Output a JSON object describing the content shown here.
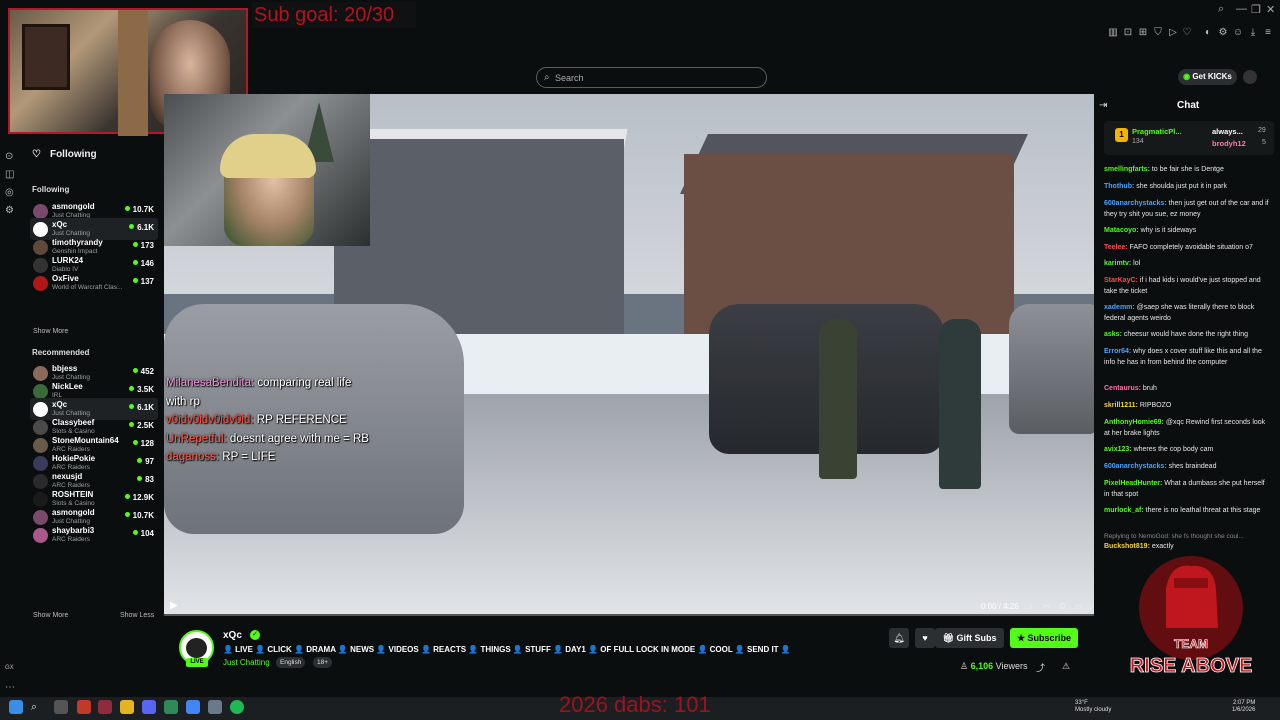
{
  "overlays": {
    "sub_goal": "Sub goal: 20/30",
    "dabs_counter": "2026 dabs: 101",
    "chat_lines": [
      {
        "user": "MilanesaBendita:",
        "text": " comparing real life"
      },
      {
        "user": "",
        "text": "with rp"
      },
      {
        "user": "v0idv0idv0idv0id:",
        "text": " RP REFERENCE"
      },
      {
        "user": "UnRepetful:",
        "text": " doesnt agree with me = RB"
      },
      {
        "user": "daganoss:",
        "text": " RP = LIFE"
      }
    ]
  },
  "search": {
    "placeholder": "Search"
  },
  "sidebar": {
    "following_header": "Following",
    "following_section": "Following",
    "following": [
      {
        "name": "asmongold",
        "category": "Just Chatting",
        "viewers": "10.7K",
        "avatar_color": "#7a4a6b"
      },
      {
        "name": "xQc",
        "category": "Just Chatting",
        "viewers": "6.1K",
        "avatar_color": "#ffffff",
        "active": true
      },
      {
        "name": "timothyrandy",
        "category": "Genshin Impact",
        "viewers": "173",
        "avatar_color": "#5f4a3a"
      },
      {
        "name": "LURK24",
        "category": "Diablo IV",
        "viewers": "146",
        "avatar_color": "#333333"
      },
      {
        "name": "OxFive",
        "category": "World of Warcraft Clas...",
        "viewers": "137",
        "avatar_color": "#b01818"
      }
    ],
    "show_more_1": "Show More",
    "recommended_section": "Recommended",
    "recommended": [
      {
        "name": "bbjess",
        "category": "Just Chatting",
        "viewers": "452",
        "avatar_color": "#8a6a5a"
      },
      {
        "name": "NickLee",
        "category": "IRL",
        "viewers": "3.5K",
        "avatar_color": "#3a6a3a"
      },
      {
        "name": "xQc",
        "category": "Just Chatting",
        "viewers": "6.1K",
        "avatar_color": "#ffffff",
        "active": true
      },
      {
        "name": "Classybeef",
        "category": "Slots & Casino",
        "viewers": "2.5K",
        "avatar_color": "#4a4a4a"
      },
      {
        "name": "StoneMountain64",
        "category": "ARC Raiders",
        "viewers": "128",
        "avatar_color": "#6a5a4a"
      },
      {
        "name": "HokiePokie",
        "category": "ARC Raiders",
        "viewers": "97",
        "avatar_color": "#3a3a5a"
      },
      {
        "name": "nexusjd",
        "category": "ARC Raiders",
        "viewers": "83",
        "avatar_color": "#2a2a2a"
      },
      {
        "name": "ROSHTEIN",
        "category": "Slots & Casino",
        "viewers": "12.9K",
        "avatar_color": "#1a1a1a"
      },
      {
        "name": "asmongold",
        "category": "Just Chatting",
        "viewers": "10.7K",
        "avatar_color": "#7a4a6b"
      },
      {
        "name": "shaybarbi3",
        "category": "ARC Raiders",
        "viewers": "104",
        "avatar_color": "#aa5a8a"
      }
    ],
    "show_more_2": "Show More",
    "show_less": "Show Less"
  },
  "player": {
    "timecode": "0:00 / 4:26"
  },
  "channel": {
    "name": "xQc",
    "live_badge": "LIVE",
    "title": "👤 LIVE 👤 CLICK 👤 DRAMA 👤 NEWS 👤 VIDEOS 👤 REACTS 👤 THINGS 👤 STUFF 👤 DAY1 👤 OF FULL LOCK IN MODE 👤 COOL 👤 SEND IT 👤",
    "category": "Just Chatting",
    "tags": [
      "English",
      "18+"
    ],
    "gift_subs": "Gift Subs",
    "subscribe": "Subscribe",
    "viewers_count": "6,106",
    "viewers_label": "Viewers"
  },
  "chat": {
    "get_kicks": "Get KICKs",
    "title": "Chat",
    "pinned": {
      "user1": "PragmaticPl...",
      "val1": "134",
      "user2": "always...",
      "val2": "29",
      "user3": "brodyh12",
      "val3": "5"
    },
    "messages": [
      {
        "user": "smellingfarts:",
        "text": " to be fair she is Dentge",
        "color": "c-green"
      },
      {
        "user": "Thothub:",
        "text": " she shoulda just put it in park",
        "color": "c-blue"
      },
      {
        "user": "600anarchystacks:",
        "text": " then just get out of the car and if they try shit you sue, ez money",
        "color": "c-blue"
      },
      {
        "user": "Matacoyo:",
        "text": " why is it sideways",
        "color": "c-green"
      },
      {
        "user": "Teelee:",
        "text": " FAFO completely avoidable situation o7",
        "color": "c-red"
      },
      {
        "user": "karimtv:",
        "text": " lol",
        "color": "c-green"
      },
      {
        "user": "StarKayC:",
        "text": " if i had kids i would've just stopped and take the ticket",
        "color": "c-red"
      },
      {
        "user": "xademm:",
        "text": " @saep she was literally there to block federal agents weirdo",
        "color": "c-blue"
      },
      {
        "user": "asks:",
        "text": " cheesur would have done the right thing",
        "color": "c-green"
      },
      {
        "user": "Error64:",
        "text": " why does x cover stuff like this and all the info he has in from behind the computer",
        "color": "c-blue"
      },
      {
        "user": "Centaurus:",
        "text": " bruh",
        "color": "c-pink"
      },
      {
        "user": "skrill1211:",
        "text": " RIPBOZO",
        "color": "c-yellow"
      },
      {
        "user": "AnthonyHomie69:",
        "text": " @xqc Rewind first seconds look at her brake lights",
        "color": "c-green"
      },
      {
        "user": "avix123:",
        "text": " wheres the cop body cam",
        "color": "c-green"
      },
      {
        "user": "600anarchystacks:",
        "text": " shes braindead",
        "color": "c-blue"
      },
      {
        "user": "PixelHeadHunter:",
        "text": " What a dumbass she put herself in that spot",
        "color": "c-green"
      },
      {
        "user": "murlock_af:",
        "text": " there is no leathal threat at this stage",
        "color": "c-green"
      },
      {
        "user": "Buckshot819:",
        "text": " exactly",
        "color": "c-yellow"
      }
    ],
    "reply_note": "Replying to NemoGod: she fs thought she coul...",
    "team_logo_line1": "TEAM",
    "team_logo_line2": "RISE ABOVE"
  },
  "taskbar": {
    "weather_temp": "33°F",
    "weather_desc": "Mostly cloudy",
    "time": "2:07 PM",
    "date": "1/6/2026"
  }
}
